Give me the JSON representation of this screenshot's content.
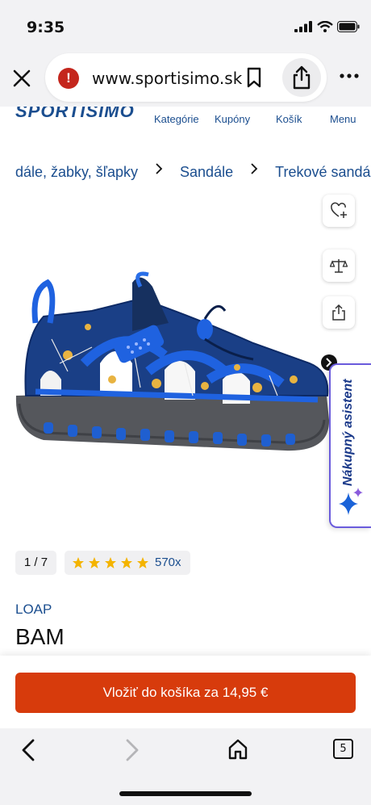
{
  "status": {
    "time": "9:35"
  },
  "browser": {
    "url": "www.sportisimo.sk",
    "tab_count": "5"
  },
  "site": {
    "logo": "SPORTISIMO",
    "nav": [
      "Kategórie",
      "Kupóny",
      "Košík",
      "Menu"
    ]
  },
  "breadcrumb": [
    "dále, žabky, šľapky",
    "Sandále",
    "Trekové sandále"
  ],
  "assistant": {
    "label": "Nákupný asistent"
  },
  "gallery": {
    "counter": "1 / 7"
  },
  "rating": {
    "stars": 5,
    "count": "570x"
  },
  "product": {
    "brand": "LOAP",
    "name": "BAM"
  },
  "cart": {
    "button_label": "Vložiť do košíka za 14,95 €"
  },
  "colors": {
    "brand_blue": "#1b4e8f",
    "cart_orange": "#d73b0c",
    "assistant_purple": "#6a5bdc",
    "star_yellow": "#f4b400"
  },
  "icons": [
    "signal-icon",
    "wifi-icon",
    "battery-icon",
    "close-icon",
    "warning-icon",
    "bookmark-icon",
    "share-icon",
    "more-icon",
    "heart-plus-icon",
    "compare-scale-icon",
    "share-product-icon",
    "sparkle-icon",
    "back-icon",
    "forward-icon",
    "home-icon",
    "tabs-icon"
  ]
}
